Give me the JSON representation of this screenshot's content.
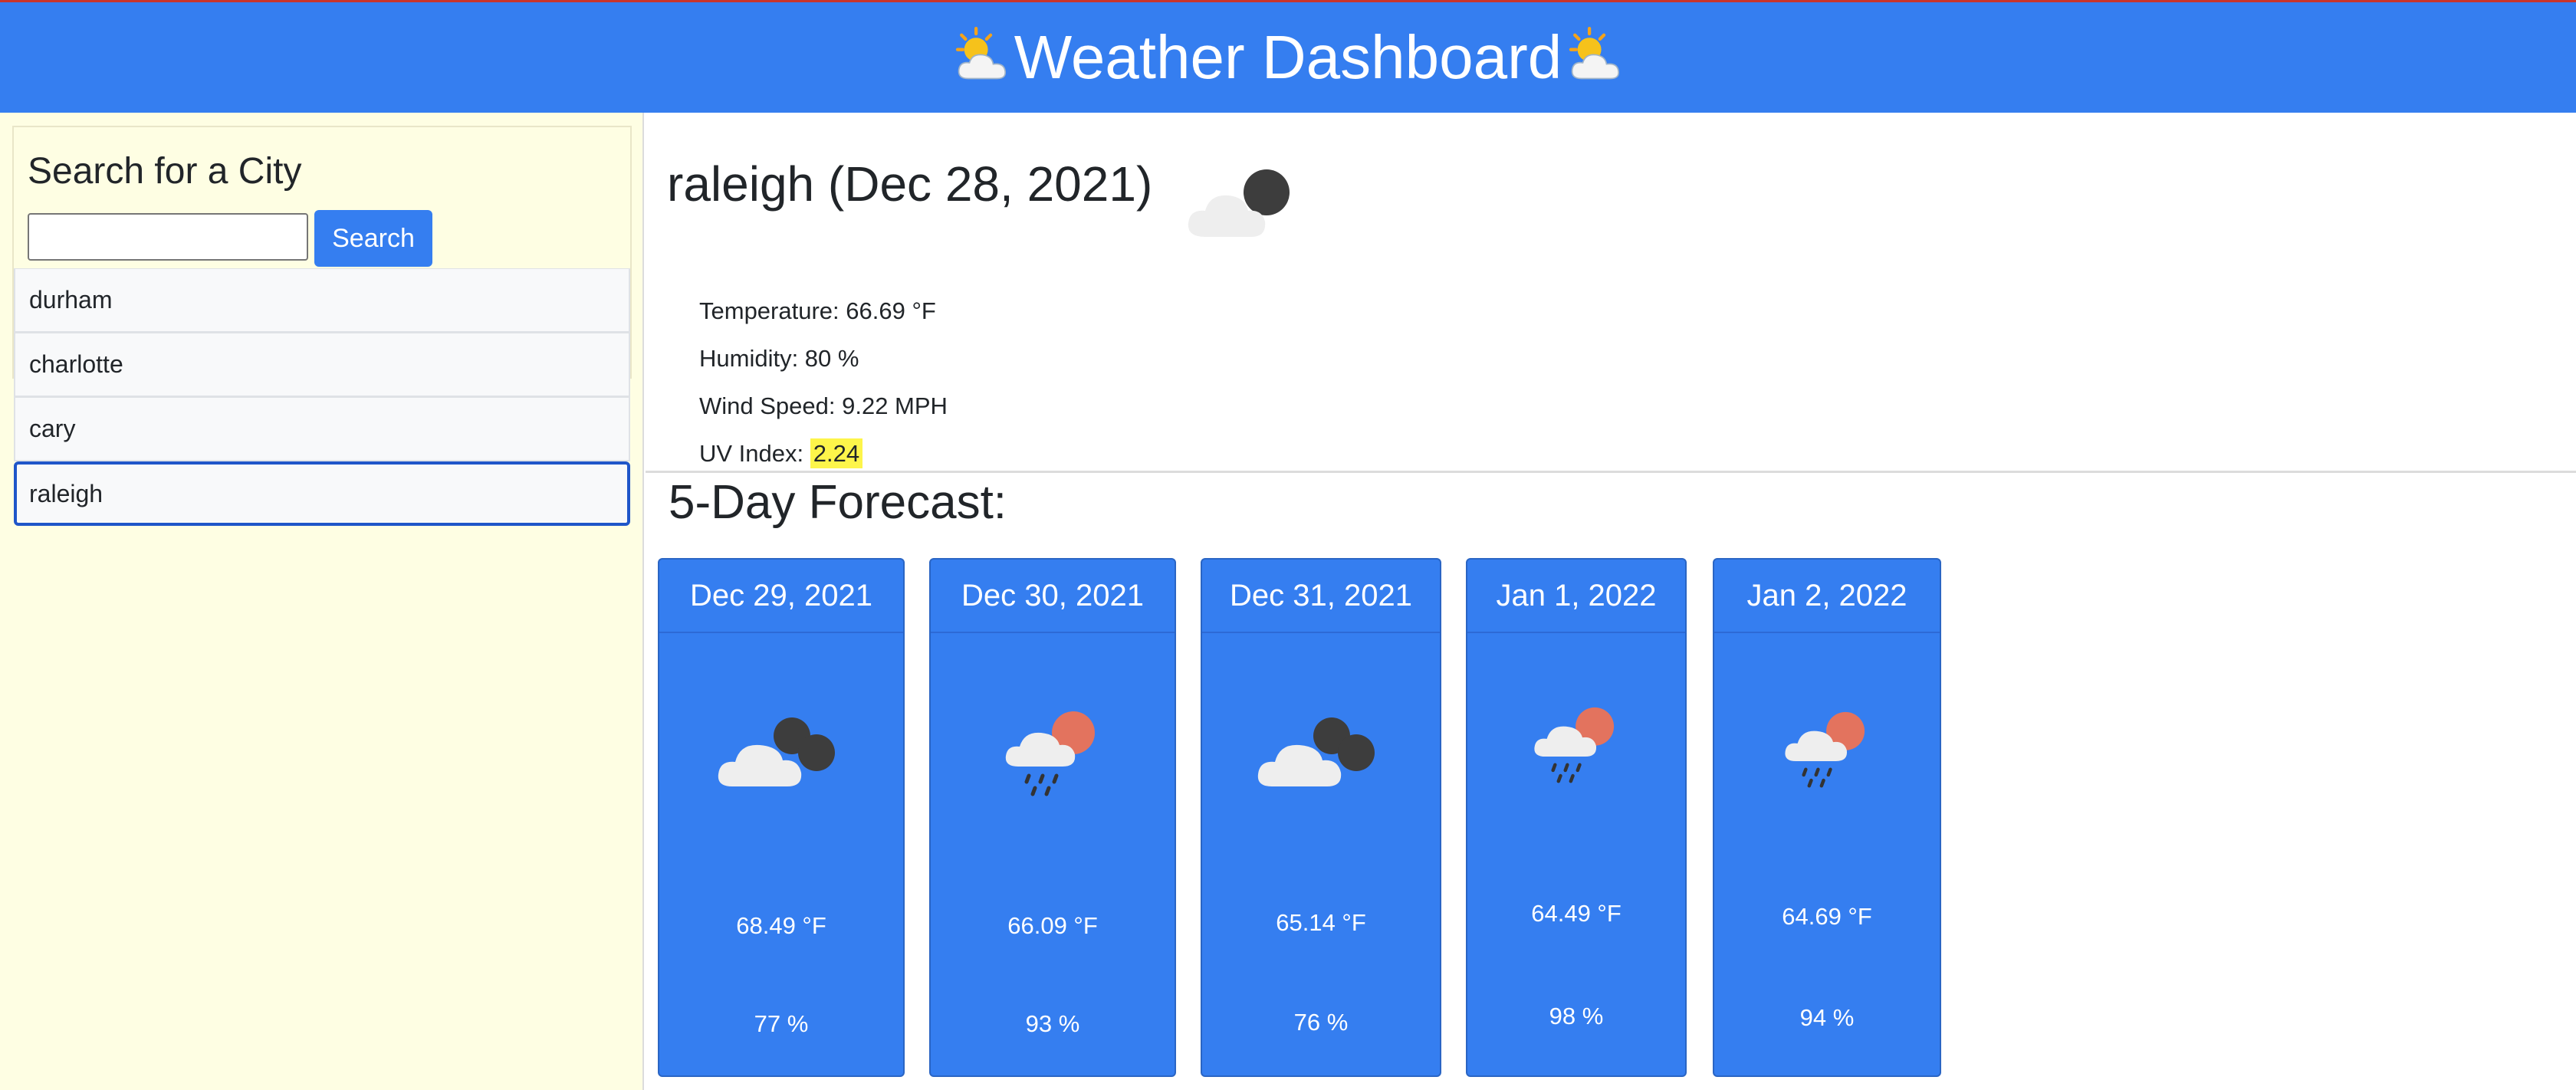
{
  "header": {
    "title": "Weather Dashboard",
    "icon": "sun-behind-cloud-icon"
  },
  "sidebar": {
    "heading": "Search for a City",
    "search_input": {
      "value": "",
      "placeholder": ""
    },
    "search_button": "Search",
    "cities": [
      "durham",
      "charlotte",
      "cary",
      "raleigh"
    ],
    "selected_city": "raleigh"
  },
  "current": {
    "title": "raleigh (Dec 28, 2021)",
    "icon": "cloud-night-icon",
    "temperature": "Temperature: 66.69 °F",
    "humidity": "Humidity: 80 %",
    "wind": "Wind Speed: 9.22 MPH",
    "uv_label": "UV Index: ",
    "uv_value": "2.24",
    "uv_color": "#fdf54a"
  },
  "forecast": {
    "title": "5-Day Forecast:",
    "days": [
      {
        "date": "Dec 29, 2021",
        "icon": "cloud-night-icon",
        "temp": "68.49 °F",
        "humidity": "77 %"
      },
      {
        "date": "Dec 30, 2021",
        "icon": "rain-sun-icon",
        "temp": "66.09 °F",
        "humidity": "93 %"
      },
      {
        "date": "Dec 31, 2021",
        "icon": "cloud-night-icon",
        "temp": "65.14 °F",
        "humidity": "76 %"
      },
      {
        "date": "Jan 1, 2022",
        "icon": "rain-sun-icon",
        "temp": "64.49 °F",
        "humidity": "98 %"
      },
      {
        "date": "Jan 2, 2022",
        "icon": "rain-sun-icon",
        "temp": "64.69 °F",
        "humidity": "94 %"
      }
    ]
  },
  "colors": {
    "primary": "#357ef0",
    "sidebar_bg": "#fefee3",
    "uv_highlight": "#fdf54a"
  }
}
